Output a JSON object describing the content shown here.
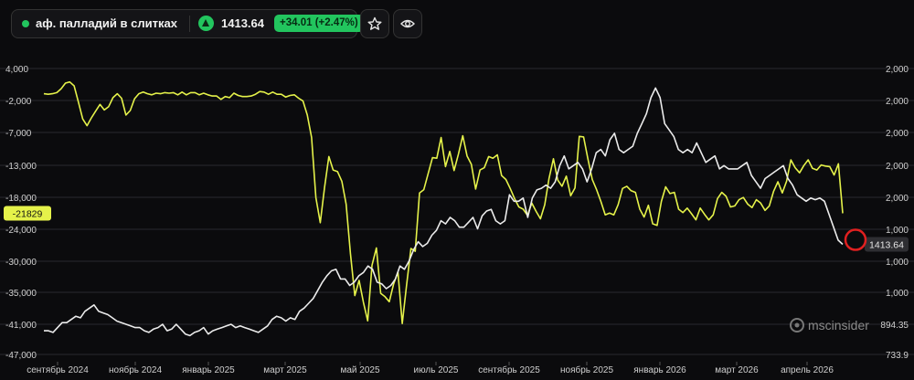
{
  "header": {
    "symbol": "аф. палладий в слитках",
    "price": "1413.64",
    "change": "+34.01 (+2.47%)",
    "icons": [
      "chevron-down-icon",
      "arrow-up-icon",
      "star-icon",
      "eye-icon"
    ]
  },
  "watermark": "mscinsider",
  "colors": {
    "background": "#0b0b0d",
    "price_line": "#ebebeb",
    "position_line": "#e5f24a",
    "up": "#22c55e",
    "marker": "#e02020"
  },
  "chart_data": {
    "type": "line",
    "x_tick_labels": [
      "сентябрь 2024",
      "ноябрь 2024",
      "январь 2025",
      "март 2025",
      "май 2025",
      "июль 2025",
      "сентябрь 2025",
      "ноябрь 2025",
      "январь 2026",
      "март 2026",
      "апрель 2026"
    ],
    "left_axis_ticks": [
      "4,000",
      "-2,000",
      "-7,000",
      "-13,000",
      "-18,000",
      "-24,000",
      "-30,000",
      "-35,000",
      "-41,000",
      "-47,000"
    ],
    "right_axis_ticks": [
      "2,000",
      "2,000",
      "2,000",
      "2,000",
      "2,000",
      "1,000",
      "1,000",
      "1,000",
      "894.35",
      "733.9"
    ],
    "left_ylim": [
      4000,
      -47000
    ],
    "right_ylim": [
      2500,
      733.9
    ],
    "left_current_label": "-21829",
    "right_current_label": "1413.64",
    "series": [
      {
        "color": "#e5f24a",
        "axis": "left",
        "values": [
          -500,
          -600,
          -500,
          -300,
          400,
          1400,
          1600,
          900,
          -2000,
          -5000,
          -6200,
          -4800,
          -3600,
          -2400,
          -3400,
          -2800,
          -1200,
          -500,
          -1300,
          -4300,
          -3500,
          -1400,
          -500,
          -200,
          -500,
          -700,
          -400,
          -500,
          -300,
          -400,
          -300,
          -700,
          -200,
          -700,
          -300,
          -300,
          -700,
          -400,
          -700,
          -900,
          -900,
          -1500,
          -1000,
          -1200,
          -400,
          -800,
          -1000,
          -1000,
          -900,
          -600,
          -100,
          -200,
          -600,
          -200,
          -600,
          -600,
          -1100,
          -800,
          -700,
          -1300,
          -1800,
          -4300,
          -8300,
          -19000,
          -23500,
          -17200,
          -11700,
          -14100,
          -14400,
          -16100,
          -20200,
          -29000,
          -36500,
          -33800,
          -37700,
          -41000,
          -31100,
          -28000,
          -36100,
          -36700,
          -37600,
          -34400,
          -32300,
          -41500,
          -34700,
          -28100,
          -28600,
          -18200,
          -17600,
          -14700,
          -11900,
          -12000,
          -8300,
          -13500,
          -10800,
          -14200,
          -11300,
          -8000,
          -11600,
          -13100,
          -17500,
          -14100,
          -13700,
          -11700,
          -12000,
          -11400,
          -15100,
          -15800,
          -17400,
          -19200,
          -20700,
          -21100,
          -22200,
          -20000,
          -21500,
          -22800,
          -20300,
          -15600,
          -12100,
          -15900,
          -17000,
          -15200,
          -18700,
          -17300,
          -8100,
          -8200,
          -12200,
          -15800,
          -17600,
          -19700,
          -22100,
          -21800,
          -22100,
          -20300,
          -17400,
          -17000,
          -17800,
          -18100,
          -21100,
          -22500,
          -20400,
          -23700,
          -24000,
          -19700,
          -17100,
          -18300,
          -18100,
          -21100,
          -21700,
          -20900,
          -21900,
          -23000,
          -20900,
          -22000,
          -23000,
          -22100,
          -19200,
          -18100,
          -18800,
          -20700,
          -20500,
          -19400,
          -19000,
          -20200,
          -20800,
          -19400,
          -20000,
          -21300,
          -20500,
          -17900,
          -16200,
          -18200,
          -16100,
          -12300,
          -13700,
          -14600,
          -13300,
          -12300,
          -13800,
          -14100,
          -13200,
          -13400,
          -13500,
          -15000,
          -13000,
          -21829
        ]
      },
      {
        "color": "#ebebeb",
        "axis": "right",
        "values": [
          880,
          880,
          870,
          900,
          930,
          930,
          950,
          970,
          960,
          1000,
          1020,
          1040,
          1000,
          990,
          980,
          960,
          940,
          930,
          920,
          910,
          900,
          900,
          880,
          870,
          890,
          900,
          920,
          880,
          890,
          920,
          890,
          860,
          850,
          870,
          880,
          900,
          860,
          880,
          890,
          900,
          910,
          920,
          900,
          910,
          900,
          890,
          880,
          870,
          890,
          910,
          950,
          970,
          960,
          940,
          960,
          950,
          1000,
          1020,
          1050,
          1080,
          1130,
          1180,
          1220,
          1250,
          1260,
          1200,
          1200,
          1160,
          1180,
          1220,
          1240,
          1280,
          1260,
          1180,
          1170,
          1140,
          1160,
          1200,
          1280,
          1260,
          1310,
          1380,
          1430,
          1400,
          1420,
          1470,
          1500,
          1560,
          1540,
          1580,
          1560,
          1520,
          1520,
          1550,
          1580,
          1510,
          1590,
          1620,
          1630,
          1560,
          1540,
          1560,
          1720,
          1680,
          1680,
          1700,
          1580,
          1700,
          1750,
          1760,
          1780,
          1760,
          1800,
          1900,
          1960,
          1880,
          1900,
          1920,
          1880,
          1800,
          1880,
          1980,
          2000,
          1960,
          2060,
          2100,
          2000,
          1980,
          2000,
          2020,
          2100,
          2160,
          2220,
          2320,
          2380,
          2320,
          2160,
          2120,
          2080,
          2000,
          1980,
          2000,
          1980,
          2040,
          1980,
          1920,
          1940,
          1960,
          1880,
          1900,
          1880,
          1880,
          1880,
          1900,
          1920,
          1840,
          1800,
          1760,
          1820,
          1840,
          1860,
          1880,
          1900,
          1820,
          1780,
          1720,
          1700,
          1680,
          1700,
          1690,
          1700,
          1680,
          1600,
          1520,
          1440,
          1413.64
        ]
      }
    ]
  }
}
